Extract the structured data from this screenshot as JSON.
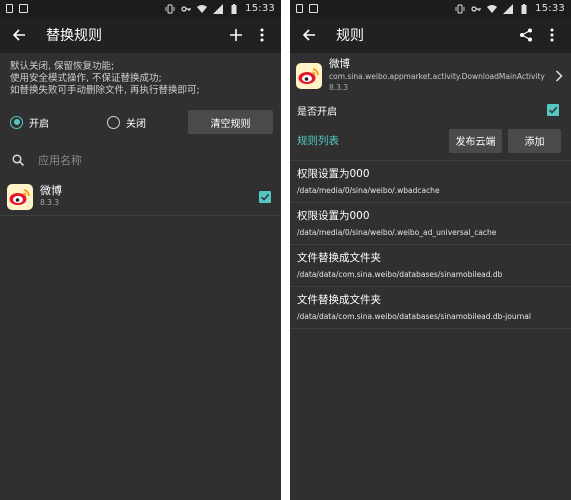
{
  "colors": {
    "accent": "#54c7c0",
    "background": "#303030",
    "toolbar": "#212121",
    "statusbar": "#1c1c1c",
    "button": "#4a4a4a"
  },
  "status_bar": {
    "time": "15:33"
  },
  "left_screen": {
    "title": "替换规则",
    "hint_lines": [
      "默认关闭, 保留恢复功能;",
      "使用安全模式操作, 不保证替换成功;",
      "如替换失败可手动删除文件, 再执行替换即可;"
    ],
    "mode": {
      "on_label": "开启",
      "off_label": "关闭",
      "selected": "on",
      "clear_button": "清空规则"
    },
    "search": {
      "placeholder": "应用名称"
    },
    "apps": [
      {
        "name": "微博",
        "version": "8.3.3",
        "checked": true,
        "icon": "weibo-icon"
      }
    ]
  },
  "right_screen": {
    "title": "规则",
    "app": {
      "name": "微博",
      "package": "com.sina.weibo.appmarket.activity.DownloadMainActivity",
      "version": "8.3.3",
      "icon": "weibo-icon"
    },
    "enabled_label": "是否开启",
    "enabled_checked": true,
    "rules_header": "规则列表",
    "publish_button": "发布云端",
    "add_button": "添加",
    "rules": [
      {
        "title": "权限设置为000",
        "path": "/data/media/0/sina/weibo/.wbadcache"
      },
      {
        "title": "权限设置为000",
        "path": "/data/media/0/sina/weibo/.weibo_ad_universal_cache"
      },
      {
        "title": "文件替换成文件夹",
        "path": "/data/data/com.sina.weibo/databases/sinamobilead.db"
      },
      {
        "title": "文件替换成文件夹",
        "path": "/data/data/com.sina.weibo/databases/sinamobilead.db-journal"
      }
    ]
  }
}
